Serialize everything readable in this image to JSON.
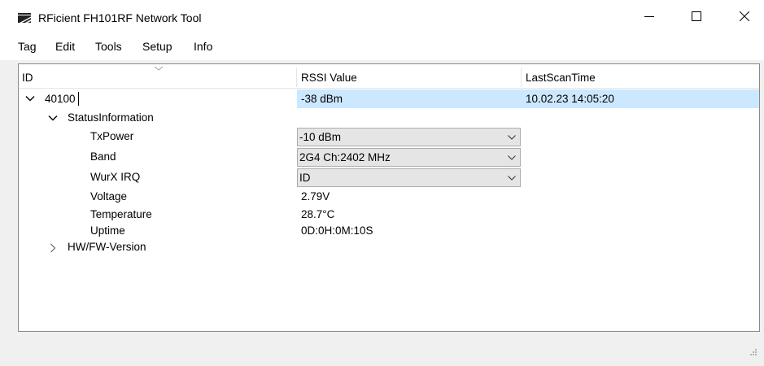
{
  "window": {
    "title": "RFicient FH101RF Network Tool"
  },
  "menu": [
    "Tag",
    "Edit",
    "Tools",
    "Setup",
    "Info"
  ],
  "columns": {
    "id": "ID",
    "rssi": "RSSI Value",
    "last_scan": "LastScanTime"
  },
  "tag": {
    "id": "40100",
    "rssi": "-38 dBm",
    "last_scan": "10.02.23 14:05:20"
  },
  "status_group": {
    "label": "StatusInformation",
    "txpower": {
      "label": "TxPower",
      "value": "-10 dBm"
    },
    "band": {
      "label": "Band",
      "value": "2G4 Ch:2402 MHz"
    },
    "wurx": {
      "label": "WurX IRQ",
      "value": "ID"
    },
    "voltage": {
      "label": "Voltage",
      "value": "2.79V"
    },
    "temperature": {
      "label": "Temperature",
      "value": "28.7°C"
    },
    "uptime": {
      "label": "Uptime",
      "value": "0D:0H:0M:10S"
    }
  },
  "hwfw_group": {
    "label": "HW/FW-Version"
  },
  "icons": [
    "app-logo-icon",
    "minimize-icon",
    "maximize-icon",
    "close-icon",
    "sort-caret-icon",
    "chevron-down-icon",
    "chevron-right-icon",
    "dropdown-arrow-icon",
    "resize-grip-icon"
  ]
}
